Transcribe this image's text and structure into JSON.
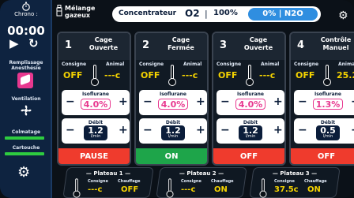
{
  "sidebar": {
    "chrono_label": "Chrono :",
    "time": "00:00",
    "remplissage_label_1": "Remplissage",
    "remplissage_label_2": "Anesthésie",
    "ventilation_label": "Ventilation",
    "colmatage_label": "Colmatage",
    "cartouche_label": "Cartouche"
  },
  "top": {
    "melange_label_1": "Mélange",
    "melange_label_2": "gazeux",
    "concentrateur_label": "Concentrateur",
    "o2_label": "O2",
    "o2_value": "100%",
    "n2o_value": "0%",
    "n2o_label": "N2O"
  },
  "cages": [
    {
      "num": "1",
      "title_1": "Cage",
      "title_2": "Ouverte",
      "consigne_label": "Consigne",
      "animal_label": "Animal",
      "consigne": "OFF",
      "animal": "---c",
      "iso_label": "Isoflurane",
      "iso_value": "4.0%",
      "debit_label": "Débit",
      "debit_value": "1.2",
      "debit_unit": "l/min",
      "state": "PAUSE",
      "state_color": "#ef3b2d"
    },
    {
      "num": "2",
      "title_1": "Cage",
      "title_2": "Fermée",
      "consigne_label": "Consigne",
      "animal_label": "Animal",
      "consigne": "OFF",
      "animal": "---c",
      "iso_label": "Isoflurane",
      "iso_value": "4.0%",
      "debit_label": "Débit",
      "debit_value": "1.2",
      "debit_unit": "l/min",
      "state": "ON",
      "state_color": "#1ea54a"
    },
    {
      "num": "3",
      "title_1": "Cage",
      "title_2": "Ouverte",
      "consigne_label": "Consigne",
      "animal_label": "Animal",
      "consigne": "OFF",
      "animal": "---c",
      "iso_label": "Isoflurane",
      "iso_value": "4.0%",
      "debit_label": "Débit",
      "debit_value": "1.2",
      "debit_unit": "l/min",
      "state": "OFF",
      "state_color": "#ef3b2d"
    },
    {
      "num": "4",
      "title_1": "Contrôle",
      "title_2": "Manuel",
      "consigne_label": "Consigne",
      "animal_label": "Animal",
      "consigne": "OFF",
      "animal": "25.2",
      "iso_label": "Isoflurane",
      "iso_value": "1.3%",
      "debit_label": "Débit",
      "debit_value": "0.5",
      "debit_unit": "l/min",
      "state": "OFF",
      "state_color": "#ef3b2d"
    }
  ],
  "plateaux": [
    {
      "title": "Plateau 1",
      "consigne_label": "Consigne",
      "chauffage_label": "Chauffage",
      "consigne": "---c",
      "chauffage": "OFF"
    },
    {
      "title": "Plateau 2",
      "consigne_label": "Consigne",
      "chauffage_label": "Chauffage",
      "consigne": "---c",
      "chauffage": "ON"
    },
    {
      "title": "Plateau 3",
      "consigne_label": "Consigne",
      "chauffage_label": "Chauffage",
      "consigne": "37.5c",
      "chauffage": "ON"
    }
  ],
  "colors": {
    "accent": "#2f8ee0",
    "value_yellow": "#f5d300",
    "isoflurane_pink": "#e8388f",
    "debit_navy": "#0b1d3a",
    "on_green": "#1ea54a",
    "off_red": "#ef3b2d"
  }
}
